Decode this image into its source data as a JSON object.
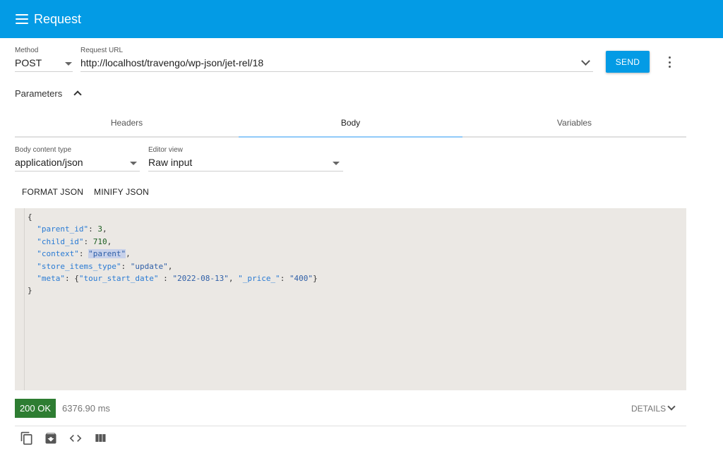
{
  "appbar": {
    "title": "Request"
  },
  "request": {
    "method_label": "Method",
    "method_value": "POST",
    "url_label": "Request URL",
    "url_value": "http://localhost/travengo/wp-json/jet-rel/18",
    "send_label": "SEND"
  },
  "parameters": {
    "label": "Parameters"
  },
  "tabs": [
    {
      "label": "Headers"
    },
    {
      "label": "Body"
    },
    {
      "label": "Variables"
    }
  ],
  "body": {
    "content_type_label": "Body content type",
    "content_type_value": "application/json",
    "editor_view_label": "Editor view",
    "editor_view_value": "Raw input",
    "format_label": "FORMAT JSON",
    "minify_label": "MINIFY JSON"
  },
  "code": {
    "open": "{",
    "close": "}",
    "lines": [
      {
        "key": "\"parent_id\"",
        "value": "3",
        "value_type": "number"
      },
      {
        "key": "\"child_id\"",
        "value": "710",
        "value_type": "number"
      },
      {
        "key": "\"context\"",
        "value": "\"parent\"",
        "value_type": "string"
      },
      {
        "key": "\"store_items_type\"",
        "value": "\"update\"",
        "value_type": "string"
      }
    ],
    "meta_key": "\"meta\"",
    "meta_k1": "\"tour_start_date\"",
    "meta_v1": "\"2022-08-13\"",
    "meta_k2": "\"_price_\"",
    "meta_v2": "\"400\""
  },
  "response": {
    "status": "200 OK",
    "time": "6376.90 ms",
    "details_label": "DETAILS"
  },
  "icons": [
    "copy-icon",
    "archive-icon",
    "code-icon",
    "columns-icon"
  ],
  "colors": {
    "primary": "#039be5",
    "status_ok": "#2e7d32",
    "editor_bg": "#ebe8e4"
  }
}
